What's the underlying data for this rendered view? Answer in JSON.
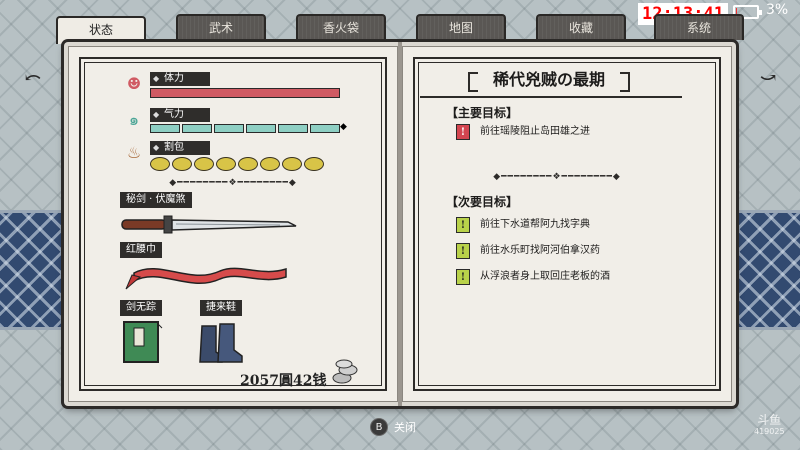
{
  "hud": {
    "time": "12:13:41",
    "battery": "3%",
    "battery_level": 0.03
  },
  "tabs": [
    {
      "label": "状态",
      "active": true
    },
    {
      "label": "武术",
      "active": false
    },
    {
      "label": "香火袋",
      "active": false
    },
    {
      "label": "地图",
      "active": false
    },
    {
      "label": "收藏",
      "active": false
    },
    {
      "label": "系统",
      "active": false
    }
  ],
  "status": {
    "hp": {
      "label": "体力",
      "value": 1.0
    },
    "ki": {
      "label": "气力",
      "segments": 6,
      "filled": 6
    },
    "food": {
      "label": "割包",
      "count": 8
    }
  },
  "equipment": {
    "weapon": "秘剑 · 伏魔煞",
    "accessory": "红腰巾",
    "book": "剑无踪",
    "shoes": "捷来鞋"
  },
  "money": "2057圓42钱",
  "quest": {
    "title": "稀代兇贼の最期",
    "main_header": "【主要目标】",
    "main": [
      "前往瑶陵阻止岛田雄之进"
    ],
    "side_header": "【次要目标】",
    "side": [
      "前往下水道帮阿九找字典",
      "前往水乐町找阿河伯拿汉药",
      "从浮浪者身上取回庄老板的酒"
    ]
  },
  "footer": {
    "button": "B",
    "close_label": "关闭"
  },
  "watermark": {
    "brand": "斗鱼",
    "id": "419025"
  }
}
